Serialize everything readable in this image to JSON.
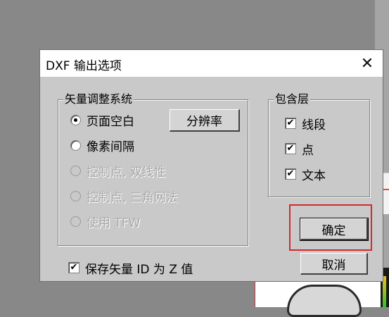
{
  "dialog": {
    "title": "DXF 输出选项",
    "close_glyph": "✕"
  },
  "vector_group": {
    "title": "矢量调整系统",
    "options": [
      {
        "label": "页面空白",
        "selected": true,
        "enabled": true
      },
      {
        "label": "像素间隔",
        "selected": false,
        "enabled": true
      },
      {
        "label": "控制点, 双线性",
        "selected": false,
        "enabled": false
      },
      {
        "label": "控制点, 三角网法",
        "selected": false,
        "enabled": false
      },
      {
        "label": "使用 TFW",
        "selected": false,
        "enabled": false
      }
    ],
    "resolution_button": "分辨率"
  },
  "layers_group": {
    "title": "包含层",
    "items": [
      {
        "label": "线段",
        "checked": true
      },
      {
        "label": "点",
        "checked": true
      },
      {
        "label": "文本",
        "checked": true
      }
    ]
  },
  "save_id_checkbox": {
    "label": "保存矢量 ID 为 Z 值",
    "checked": true
  },
  "buttons": {
    "ok": "确定",
    "cancel": "取消"
  },
  "check_glyph": "✔",
  "colors": {
    "highlight": "#d42a2a",
    "dialog_bg": "#c9c9c9"
  }
}
